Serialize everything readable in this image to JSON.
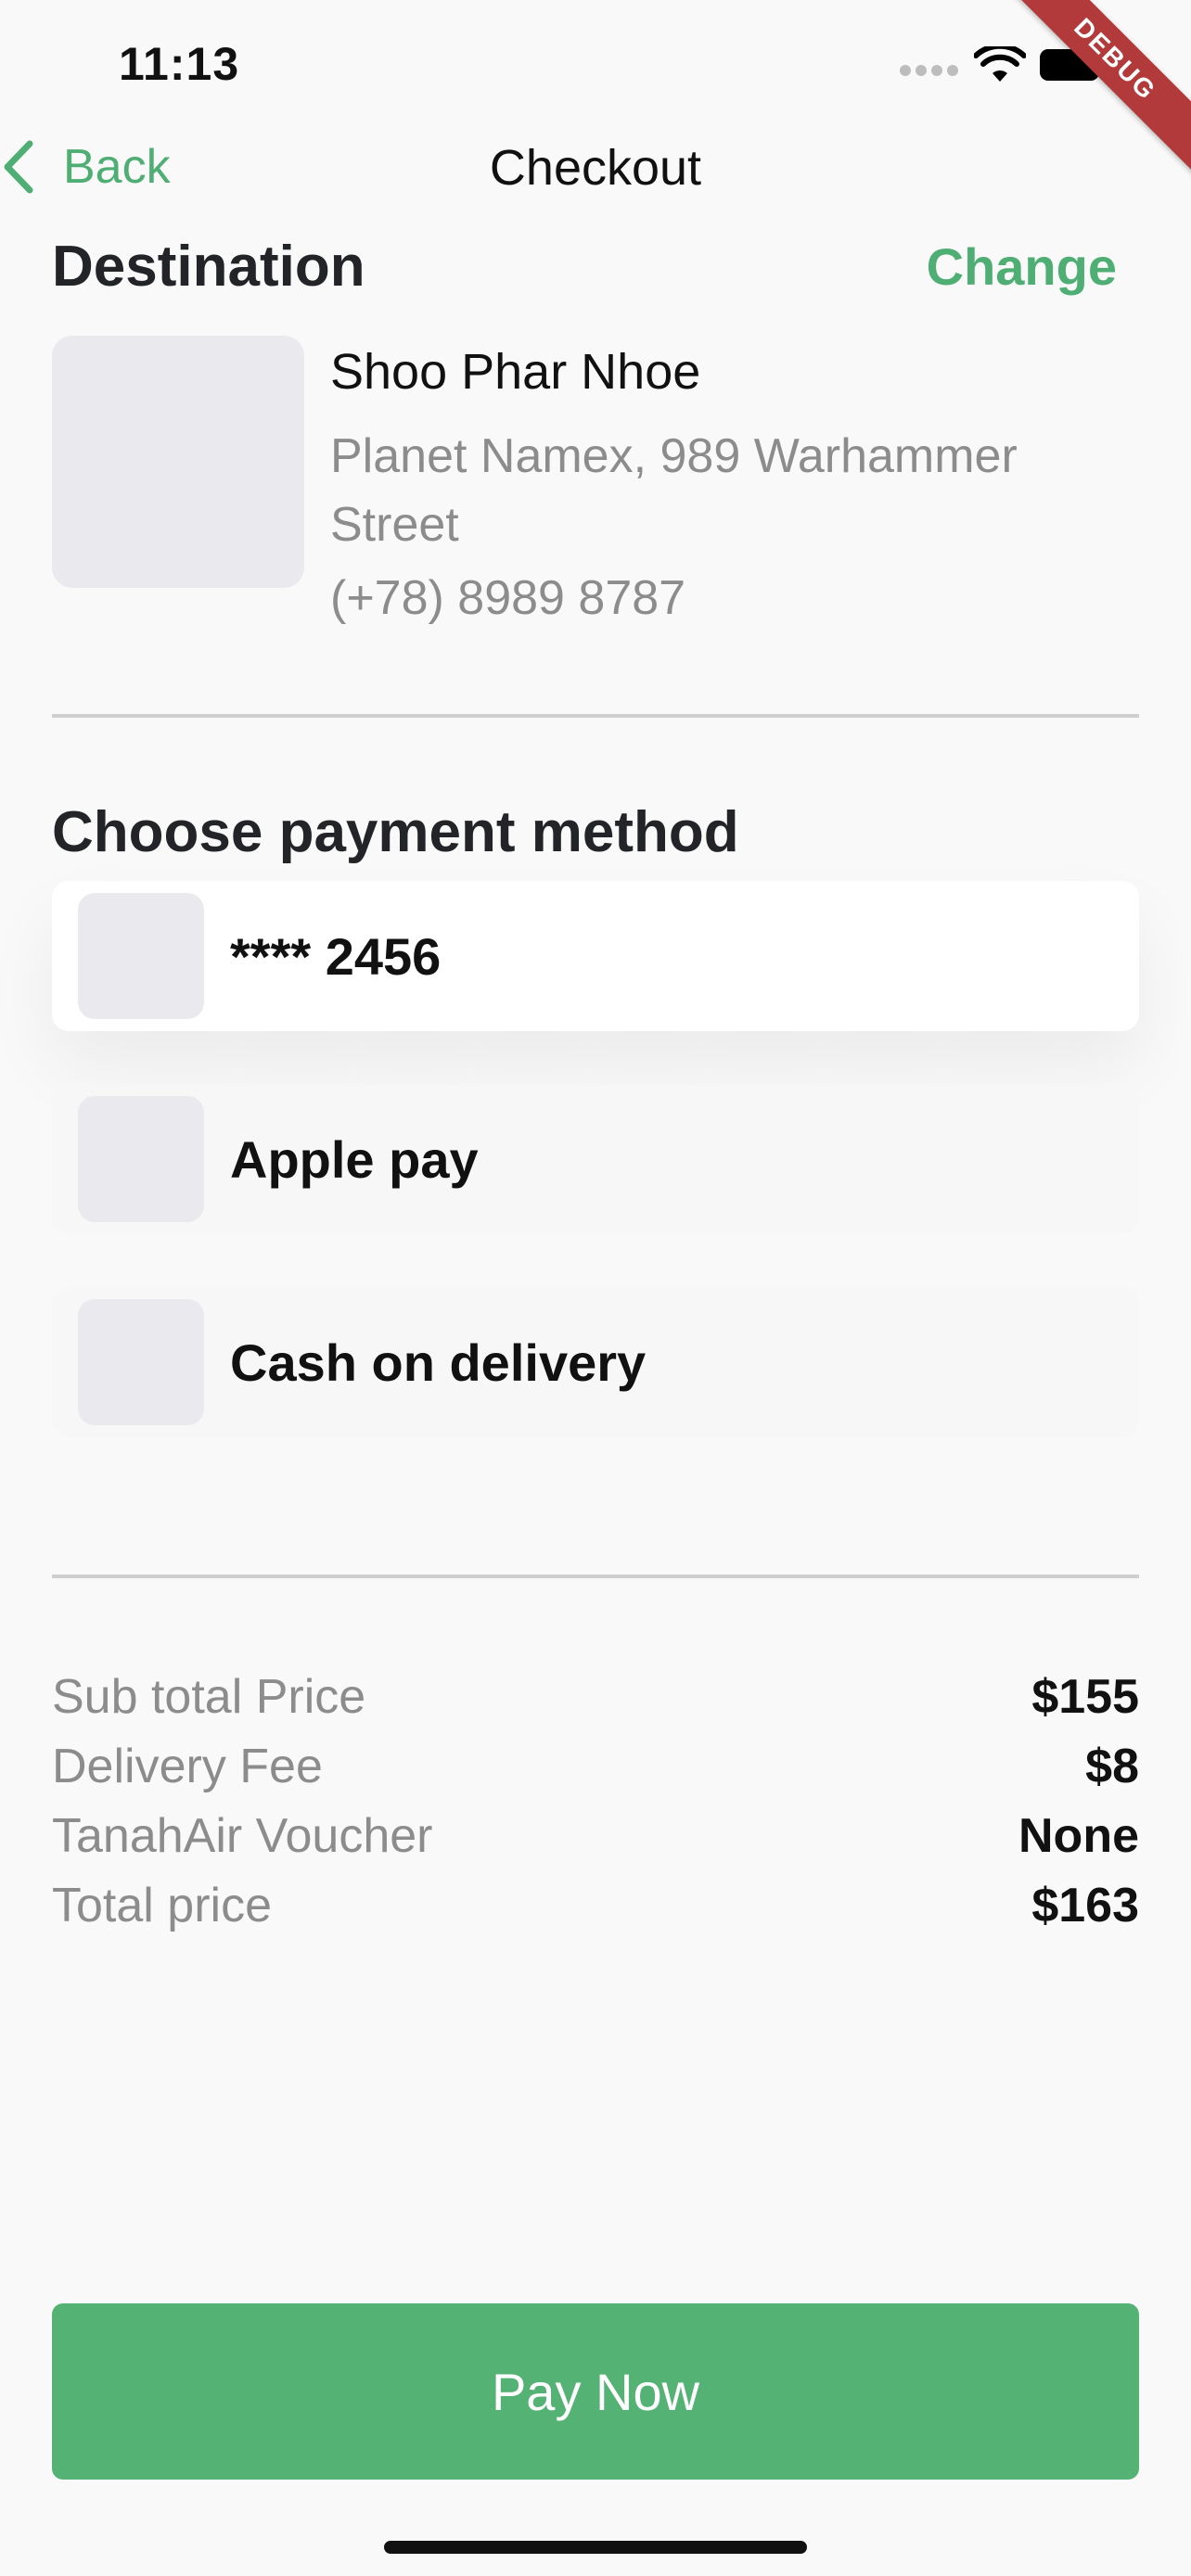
{
  "status_bar": {
    "time": "11:13"
  },
  "debug_ribbon": "DEBUG",
  "nav": {
    "back_label": "Back",
    "title": "Checkout"
  },
  "destination": {
    "title": "Destination",
    "change_label": "Change",
    "name": "Shoo Phar Nhoe",
    "address": "Planet Namex, 989 Warhammer Street",
    "phone": "(+78) 8989 8787"
  },
  "payment": {
    "title": "Choose payment method",
    "methods": [
      {
        "label": "**** 2456",
        "selected": true
      },
      {
        "label": "Apple pay",
        "selected": false
      },
      {
        "label": "Cash on delivery",
        "selected": false
      }
    ]
  },
  "summary": {
    "rows": [
      {
        "label": "Sub total Price",
        "value": "$155"
      },
      {
        "label": "Delivery Fee",
        "value": "$8"
      },
      {
        "label": "TanahAir Voucher",
        "value": "None"
      },
      {
        "label": "Total price",
        "value": "$163"
      }
    ]
  },
  "pay_button": {
    "label": "Pay Now"
  },
  "colors": {
    "accent": "#4fae73",
    "button": "#54b275",
    "muted_text": "#8c8c8c",
    "placeholder": "#e9e9ee"
  }
}
